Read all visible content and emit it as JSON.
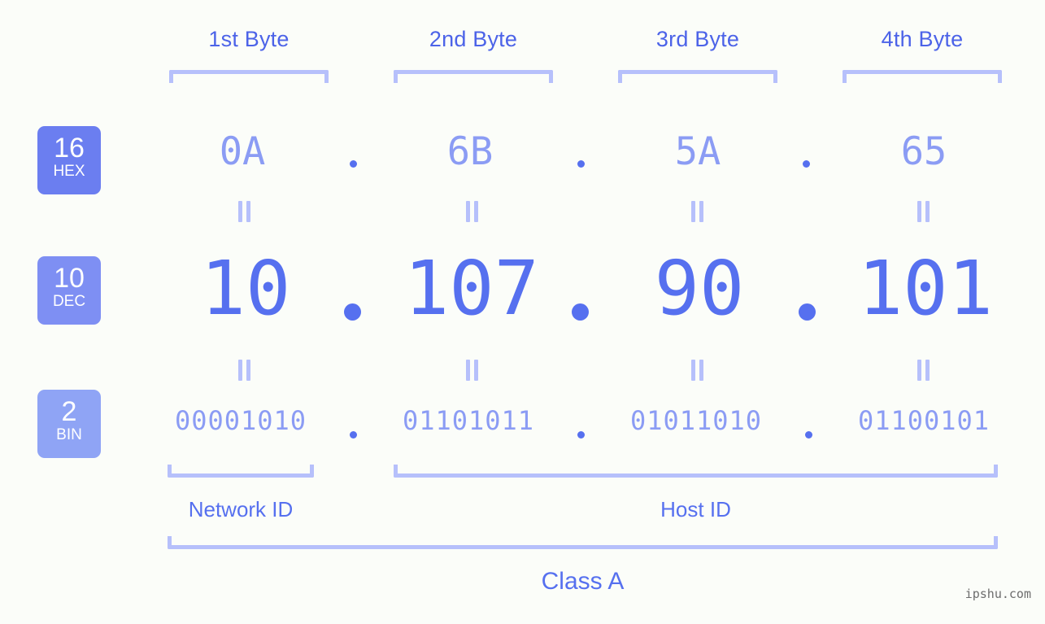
{
  "watermark": "ipshu.com",
  "byte_headers": [
    {
      "label": "1st Byte"
    },
    {
      "label": "2nd Byte"
    },
    {
      "label": "3rd Byte"
    },
    {
      "label": "4th Byte"
    }
  ],
  "bases": [
    {
      "number": "16",
      "abbr": "HEX",
      "color": "#6b7ef0"
    },
    {
      "number": "10",
      "abbr": "DEC",
      "color": "#7e8ff3"
    },
    {
      "number": "2",
      "abbr": "BIN",
      "color": "#8fa4f5"
    }
  ],
  "rows": {
    "hex": {
      "values": [
        "0A",
        "6B",
        "5A",
        "65"
      ],
      "separator": "."
    },
    "dec": {
      "values": [
        "10",
        "107",
        "90",
        "101"
      ],
      "separator": "."
    },
    "bin": {
      "values": [
        "00001010",
        "01101011",
        "01011010",
        "01100101"
      ],
      "separator": "."
    }
  },
  "connectors": {
    "glyph": "=",
    "count": 8
  },
  "sections": [
    {
      "label": "Network ID"
    },
    {
      "label": "Host ID"
    }
  ],
  "class": {
    "label": "Class A"
  },
  "colors": {
    "background": "#fbfdf9",
    "accent_strong": "#5670ef",
    "accent_mid": "#8b9cf4",
    "accent_light": "#b6c0fb",
    "header_text": "#4c63e8"
  }
}
